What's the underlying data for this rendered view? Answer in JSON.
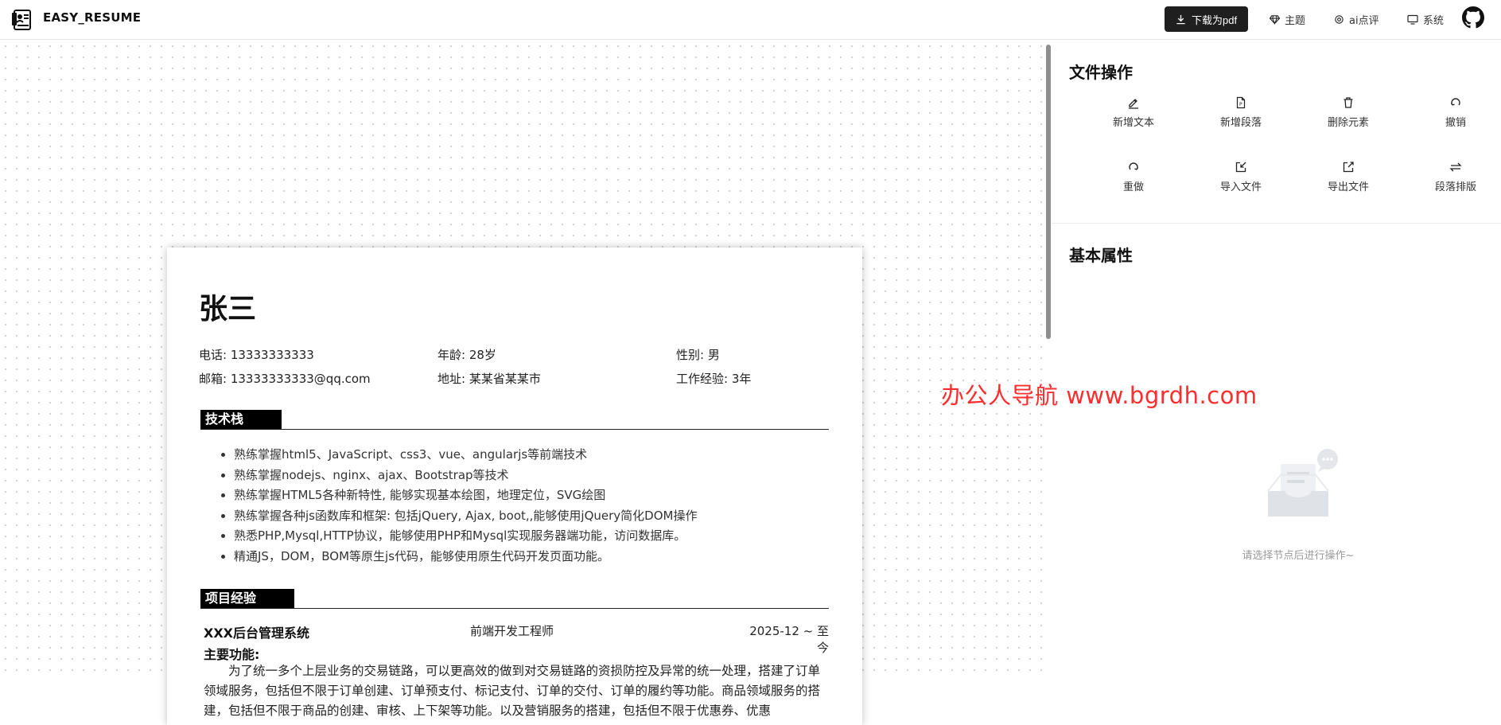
{
  "header": {
    "brand": "EASY_RESUME",
    "download_label": "下载为pdf",
    "nav": [
      "主题",
      "ai点评",
      "系统"
    ],
    "nav_icons": [
      "gem-icon",
      "ai-icon",
      "monitor-icon"
    ],
    "github_icon": "github-icon"
  },
  "resume": {
    "name": "张三",
    "info": [
      [
        "电话: 13333333333",
        "年龄: 28岁",
        "性别: 男"
      ],
      [
        "邮箱: 13333333333@qq.com",
        "地址: 某某省某某市",
        "工作经验: 3年"
      ]
    ],
    "sections": {
      "skills_title": "技术栈",
      "project_title": "项目经验"
    },
    "skills": [
      "熟练掌握html5、JavaScript、css3、vue、angularjs等前端技术",
      "熟练掌握nodejs、nginx、ajax、Bootstrap等技术",
      "熟练掌握HTML5各种新特性, 能够实现基本绘图，地理定位，SVG绘图",
      "熟练掌握各种js函数库和框架: 包括jQuery, Ajax, boot,,能够使用jQuery简化DOM操作",
      "熟悉PHP,Mysql,HTTP协议，能够使用PHP和Mysql实现服务器端功能，访问数据库。",
      "精通JS，DOM，BOM等原生js代码，能够使用原生代码开发页面功能。"
    ],
    "project": {
      "name": "XXX后台管理系统",
      "role": "前端开发工程师",
      "date": "2025-12 ~ 至今",
      "main_func_label": "主要功能:",
      "description": "为了统一多个上层业务的交易链路，可以更高效的做到对交易链路的资损防控及异常的统一处理，搭建了订单领域服务，包括但不限于订单创建、订单预支付、标记支付、订单的交付、订单的履约等功能。商品领域服务的搭建，包括但不限于商品的创建、审核、上下架等功能。以及营销服务的搭建，包括但不限于优惠券、优惠"
    }
  },
  "panel": {
    "file_ops_title": "文件操作",
    "ops": [
      {
        "label": "新增文本",
        "icon": "edit-text-icon"
      },
      {
        "label": "新增段落",
        "icon": "file-paragraph-icon"
      },
      {
        "label": "删除元素",
        "icon": "trash-icon"
      },
      {
        "label": "撤销",
        "icon": "undo-icon"
      },
      {
        "label": "重做",
        "icon": "redo-icon"
      },
      {
        "label": "导入文件",
        "icon": "import-icon"
      },
      {
        "label": "导出文件",
        "icon": "export-icon"
      },
      {
        "label": "段落排版",
        "icon": "swap-arrows-icon"
      }
    ],
    "props_title": "基本属性",
    "empty_text": "请选择节点后进行操作~",
    "empty_icon": "empty-inbox-icon"
  },
  "watermark": "办公人导航  www.bgrdh.com",
  "colors": {
    "accent_dark": "#1f1f1f",
    "watermark": "#ff2d2d",
    "section_tag_bg": "#000000"
  }
}
